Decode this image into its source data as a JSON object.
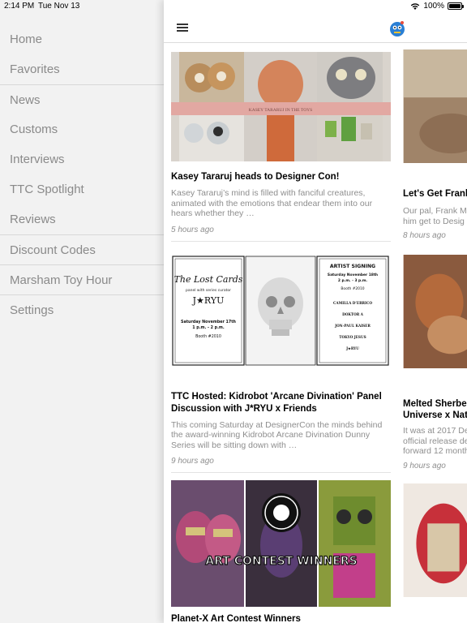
{
  "status_bar": {
    "time": "2:14 PM",
    "date": "Tue Nov 13",
    "battery": "100%"
  },
  "sidebar": {
    "items": [
      {
        "label": "Home"
      },
      {
        "label": "Favorites"
      },
      {
        "label": "News"
      },
      {
        "label": "Customs"
      },
      {
        "label": "Interviews"
      },
      {
        "label": "TTC Spotlight"
      },
      {
        "label": "Reviews"
      },
      {
        "label": "Discount Codes"
      },
      {
        "label": "Marsham Toy Hour"
      },
      {
        "label": "Settings"
      }
    ]
  },
  "articles": [
    {
      "banner": "KASEY TARARUJ IN THE TOYS",
      "title": "Kasey Tararuj heads to Designer Con!",
      "excerpt": "Kasey Tararuj’s mind is filled with fanciful creatures, animated with the emotions that endear them into our hears whether they …",
      "time": "5 hours ago"
    },
    {
      "poster": {
        "left_title": "The Lost Cards",
        "left_sub": "panel with series curator",
        "left_name": "J★RYU",
        "left_date": "Saturday November 17th",
        "left_hours": "1 p.m. - 2 p.m.",
        "left_booth": "Booth #2010",
        "right_title": "ARTIST SIGNING",
        "right_date": "Saturday November 18th",
        "right_hours": "2 p.m. - 3 p.m.",
        "right_booth": "Booth #2010",
        "artists": [
          "CAMILLA D’ERRICO",
          "DOKTOR A",
          "JON-PAUL KAISER",
          "TOKYO JESUS",
          "J★RYU"
        ]
      },
      "title": "TTC Hosted: Kidrobot 'Arcane Divination' Panel Discussion with J*RYU x Friends",
      "excerpt": "This coming Saturday at DesignerCon the minds behind the award-winning Kidrobot Arcane Divination Dunny Series will be sitting down with …",
      "time": "9 hours ago"
    },
    {
      "banner": "ART CONTEST WINNERS",
      "title": "Planet-X Art Contest Winners"
    }
  ],
  "peek_articles": [
    {
      "title": "Let's Get Frank",
      "excerpt_lines": [
        "Our pal, Frank M",
        "him get to Desig"
      ],
      "time": "8 hours ago"
    },
    {
      "title_lines": [
        "Melted Sherbe",
        "Universe x Nat"
      ],
      "excerpt_lines": [
        "It was at 2017 De",
        "official release de",
        "forward 12 month"
      ],
      "time": "9 hours ago"
    }
  ],
  "icons": {
    "menu": "hamburger-menu-icon",
    "logo": "blue-robot-logo-icon",
    "wifi": "wifi-icon",
    "battery": "battery-icon"
  }
}
